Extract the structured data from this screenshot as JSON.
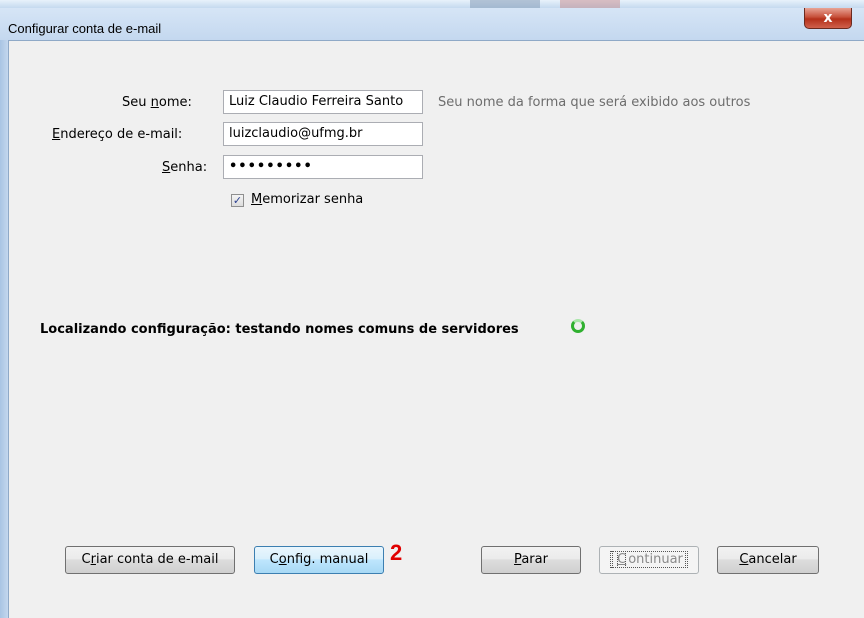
{
  "window": {
    "title": "Configurar conta de e-mail",
    "close_label": "x"
  },
  "form": {
    "name_label": {
      "pre": "Seu ",
      "key": "n",
      "post": "ome:"
    },
    "name_value": "Luiz Claudio Ferreira Santo",
    "name_hint": "Seu nome da forma que será exibido aos outros",
    "email_label": {
      "pre": "",
      "key": "E",
      "post": "ndereço de e-mail:"
    },
    "email_value": "luizclaudio@ufmg.br",
    "password_label": {
      "pre": "",
      "key": "S",
      "post": "enha:"
    },
    "password_value": "•••••••••",
    "remember": {
      "checked": true,
      "check_glyph": "✓",
      "pre": "",
      "key": "M",
      "post": "emorizar senha"
    }
  },
  "status": {
    "text": "Localizando configuração: testando nomes comuns de servidores"
  },
  "buttons": {
    "create": {
      "pre": "C",
      "key": "r",
      "post": "iar conta de e-mail"
    },
    "manual": {
      "pre": "C",
      "key": "o",
      "post": "nfig. manual"
    },
    "stop": {
      "pre": "",
      "key": "P",
      "post": "arar"
    },
    "continue": {
      "pre": "",
      "key": "C",
      "post": "ontinuar",
      "disabled": true
    },
    "cancel": {
      "pre": "",
      "key": "C",
      "post": "ancelar"
    }
  },
  "annotation": {
    "marker": "2",
    "color": "#e00000"
  },
  "colors": {
    "spinner": "#2fb02f",
    "close": "#c7503a"
  }
}
